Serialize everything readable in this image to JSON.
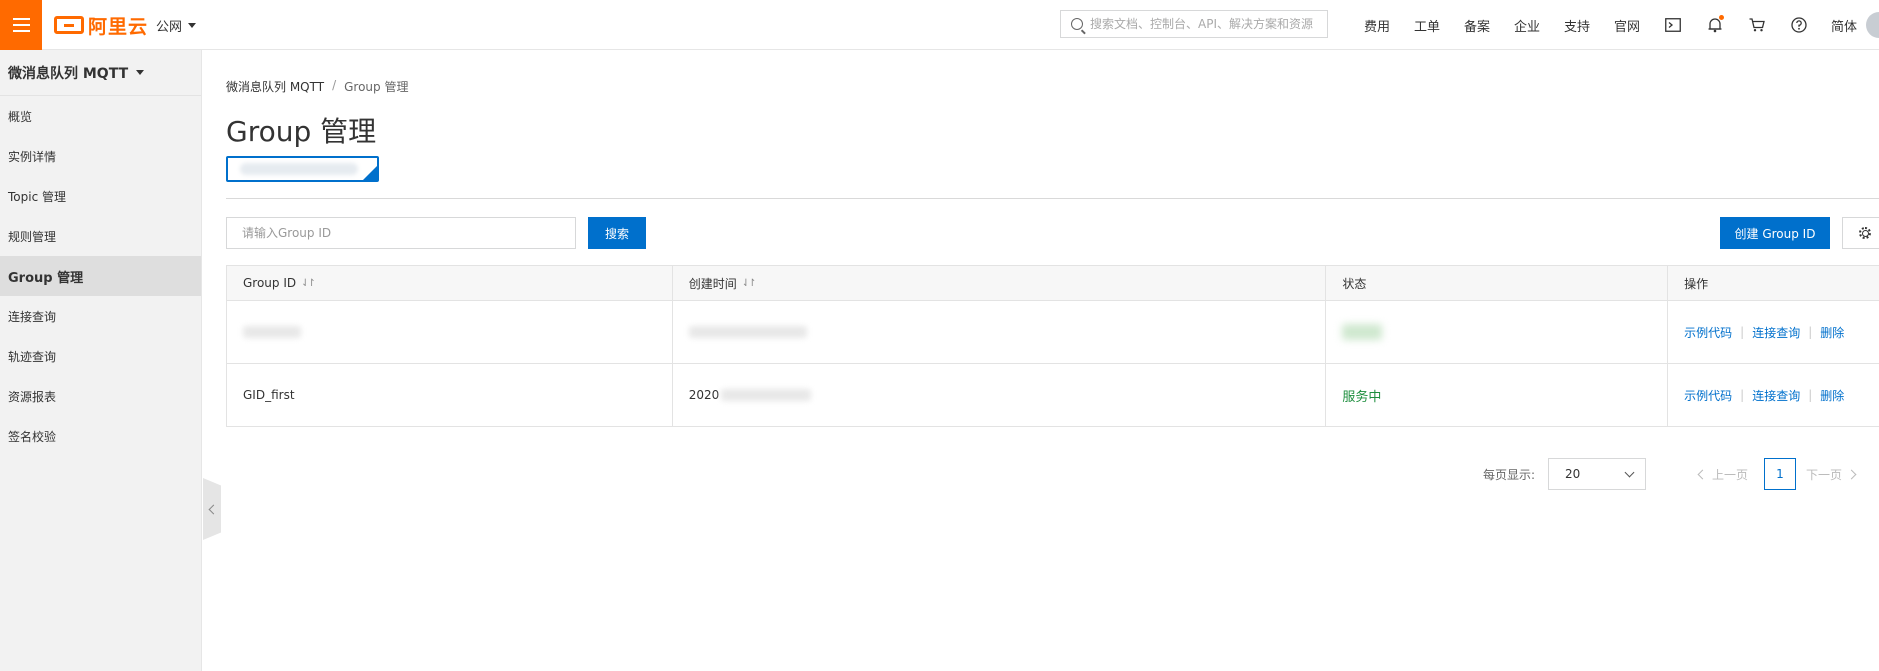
{
  "topbar": {
    "logo_text": "阿里云",
    "region": "公网",
    "search_placeholder": "搜索文档、控制台、API、解决方案和资源",
    "nav": [
      "费用",
      "工单",
      "备案",
      "企业",
      "支持",
      "官网"
    ],
    "lang": "简体",
    "icons": [
      "terminal-icon",
      "bell-icon",
      "cart-icon",
      "help-icon"
    ],
    "accent_color": "#ff6a00"
  },
  "sidebar": {
    "title": "微消息队列 MQTT",
    "items": [
      {
        "label": "概览"
      },
      {
        "label": "实例详情"
      },
      {
        "label": "Topic 管理"
      },
      {
        "label": "规则管理"
      },
      {
        "label": "Group 管理",
        "active": true
      },
      {
        "label": "连接查询"
      },
      {
        "label": "轨迹查询"
      },
      {
        "label": "资源报表"
      },
      {
        "label": "签名校验"
      }
    ]
  },
  "main": {
    "breadcrumb": [
      "微消息队列 MQTT",
      "Group 管理"
    ],
    "breadcrumb_sep": "/",
    "title": "Group 管理",
    "search_placeholder": "请输入Group ID",
    "search_button": "搜索",
    "create_button": "创建 Group ID",
    "primary_color": "#0070cc",
    "table": {
      "columns": [
        "Group ID",
        "创建时间",
        "状态",
        "操作"
      ],
      "rows": [
        {
          "group_id": "",
          "created": "",
          "status": ""
        },
        {
          "group_id": "GID_first",
          "created": "2020",
          "status": "服务中"
        }
      ],
      "actions": [
        "示例代码",
        "连接查询",
        "删除"
      ]
    },
    "pagination": {
      "page_size_label": "每页显示:",
      "page_size": "20",
      "prev": "上一页",
      "next": "下一页",
      "current_page": "1"
    }
  }
}
